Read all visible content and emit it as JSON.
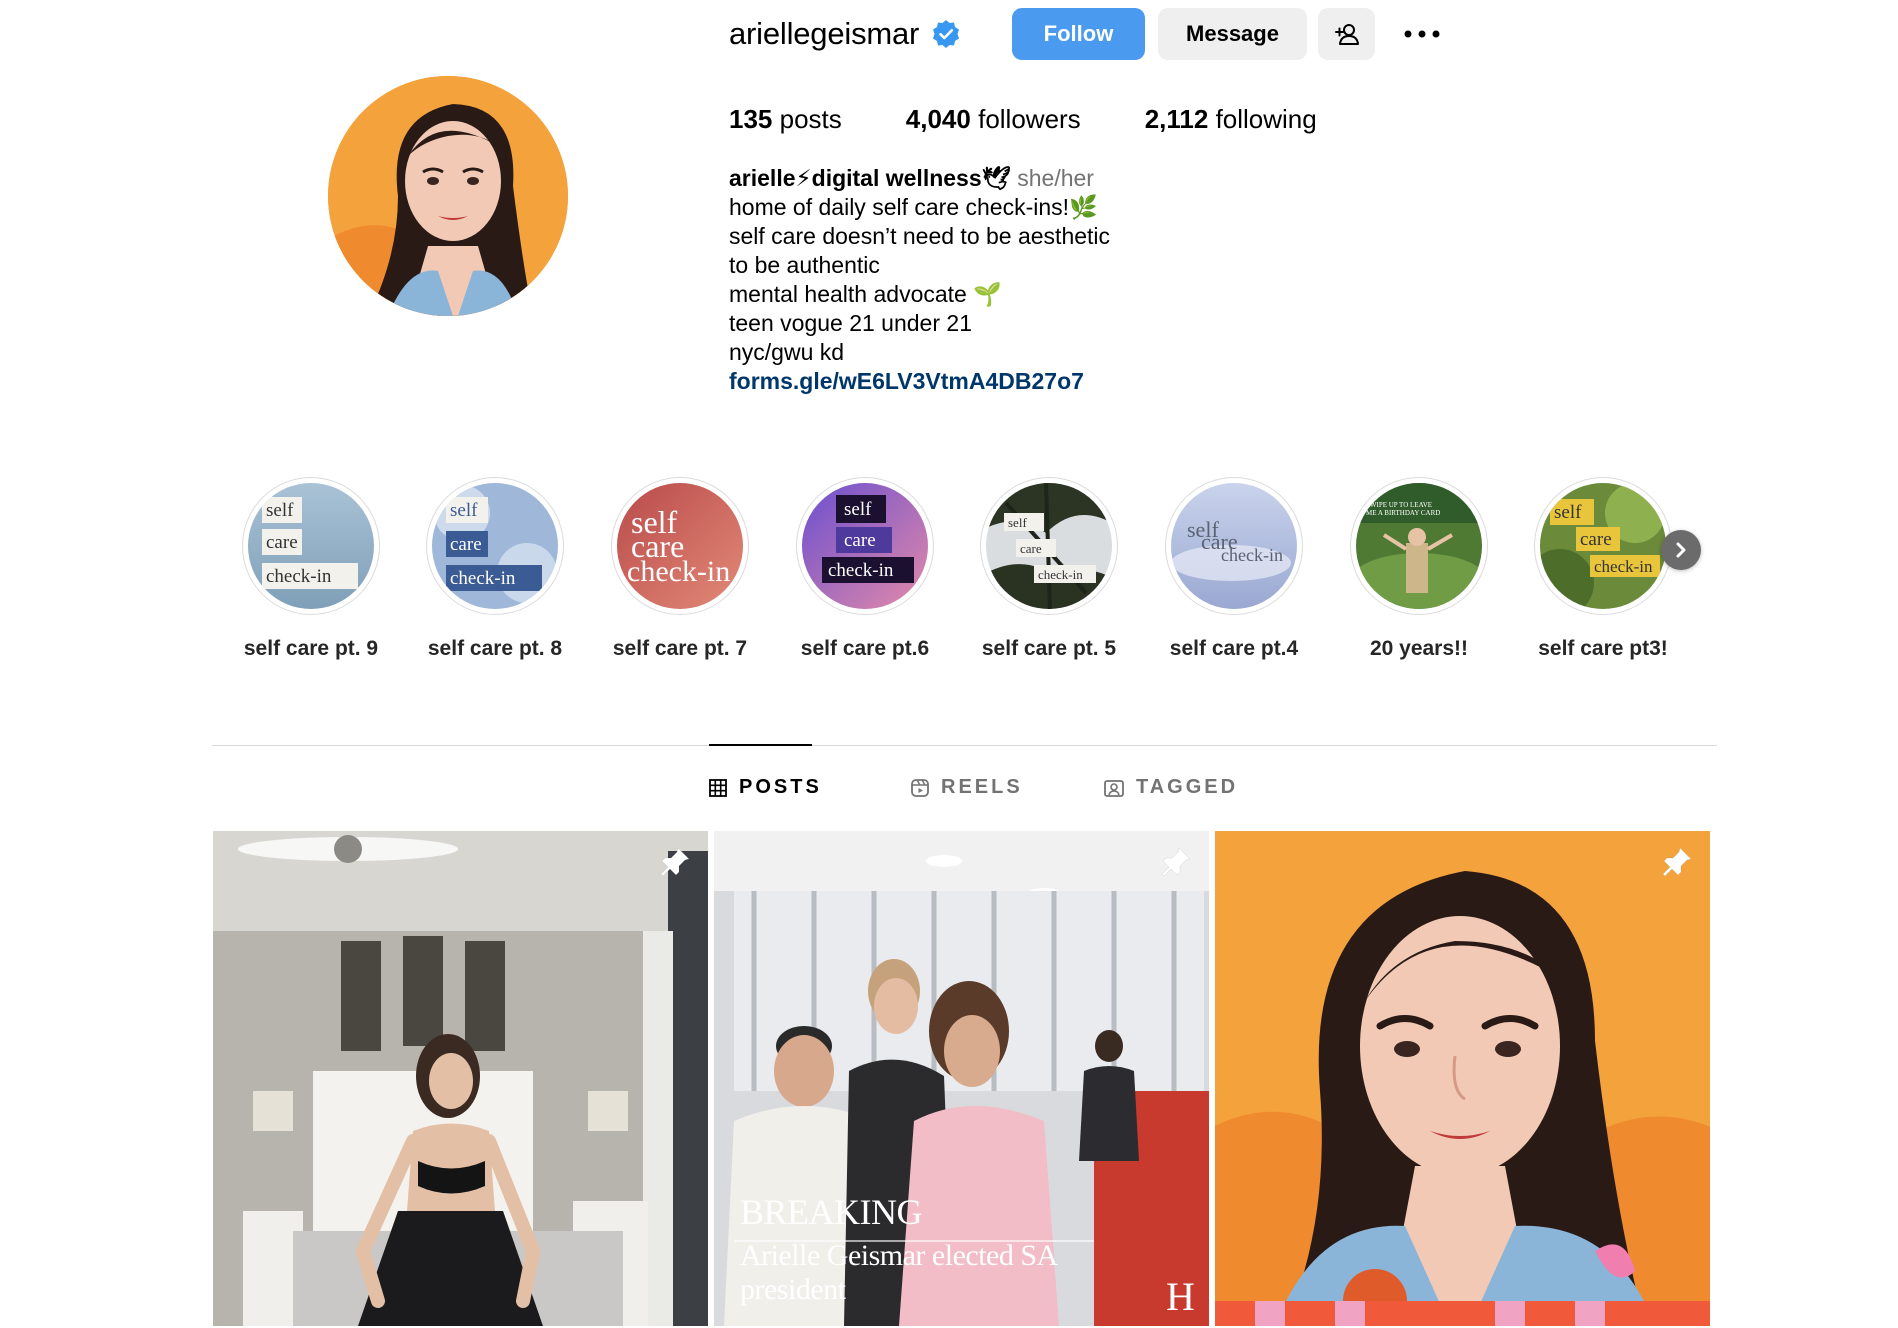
{
  "profile": {
    "username": "ariellegeismar",
    "verified": true,
    "follow_label": "Follow",
    "message_label": "Message",
    "stats": {
      "posts_count": "135",
      "posts_label": "posts",
      "followers_count": "4,040",
      "followers_label": "followers",
      "following_count": "2,112",
      "following_label": "following"
    },
    "bio": {
      "name": "arielle⚡digital wellness🕊",
      "pronouns": "she/her",
      "lines": [
        "home of daily self care check-ins!🌿",
        "self care doesn’t need to be aesthetic",
        "to be authentic",
        "mental health advocate 🌱",
        "teen vogue 21 under 21",
        "nyc/gwu kd"
      ],
      "link": "forms.gle/wE6LV3VtmA4DB27o7"
    }
  },
  "highlights": [
    {
      "label": "self care pt. 9",
      "words": [
        "self",
        "care",
        "check-in"
      ]
    },
    {
      "label": "self care pt. 8",
      "words": [
        "self",
        "care",
        "check-in"
      ]
    },
    {
      "label": "self care pt. 7",
      "words": [
        "self",
        "care",
        "check-in"
      ]
    },
    {
      "label": "self care pt.6",
      "words": [
        "self",
        "care",
        "check-in"
      ]
    },
    {
      "label": "self care pt. 5",
      "words": [
        "self",
        "care",
        "check-in"
      ]
    },
    {
      "label": "self care pt.4",
      "words": [
        "self",
        "care",
        "check-in"
      ]
    },
    {
      "label": "20 years!!",
      "words": [
        "SWIPE UP TO LEAVE",
        "ME A BIRTHDAY CARD"
      ]
    },
    {
      "label": "self care pt3!",
      "words": [
        "self",
        "care",
        "check-in"
      ]
    }
  ],
  "tabs": [
    {
      "label": "POSTS",
      "active": true
    },
    {
      "label": "REELS",
      "active": false
    },
    {
      "label": "TAGGED",
      "active": false
    }
  ],
  "posts": [
    {
      "pinned": true
    },
    {
      "pinned": true,
      "overlay_title": "BREAKING",
      "overlay_text": "Arielle Geismar elected SA president",
      "corner_mark": "H"
    },
    {
      "pinned": true
    }
  ],
  "colors": {
    "accent": "#4a9bf0",
    "link": "#00376b",
    "muted": "#737373",
    "button_bg": "#efefef"
  }
}
